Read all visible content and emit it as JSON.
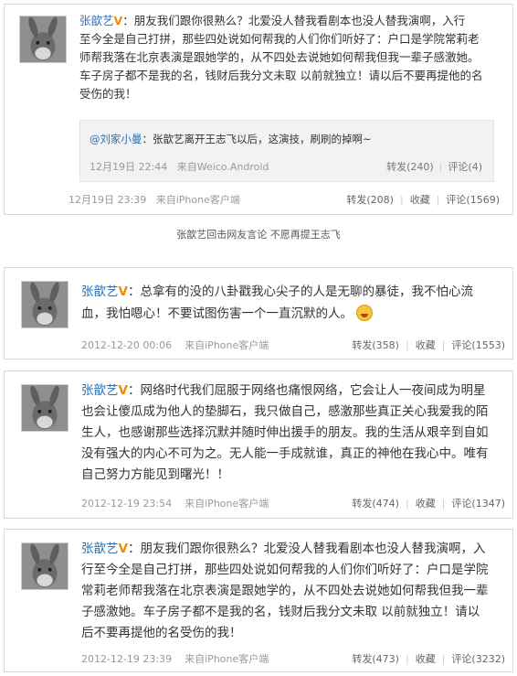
{
  "posts": [
    {
      "author": "张歆艺",
      "badge": "V",
      "text_lines": [
        "：朋友我们跟你很熟么？北爱没人替我看剧本也没人替我演啊，入行",
        "至今全是自己打拼，那些四处说如何帮我的人们你们听好了：户口是学院常莉老",
        "师帮我落在北京表演是跟她学的，从不四处去说她如何帮我但我一辈子感激她。",
        "车子房子都不是我的名，钱财后我分文未取 以前就独立！请以后不要再提他的名",
        "受伤的我！"
      ],
      "quote": {
        "author": "@刘家小曼",
        "text": "：张歆艺离开王志飞以后，这演技，刷刷的掉啊~",
        "time": "12月19日 22:44",
        "source": "来自Weico.Android",
        "repost": "转发(240)",
        "comment": "评论(4)"
      },
      "time": "12月19日 23:39",
      "source": "来自iPhone客户端",
      "repost": "转发(208)",
      "favorite": "收藏",
      "comment": "评论(1569)"
    },
    {
      "author": "张歆艺",
      "badge": "V",
      "text_lines": [
        "：总拿有的没的八卦戳我心尖子的人是无聊的暴徒，我不怕心流",
        "血，我怕嗯心！不要试图伤害一个一直沉默的人。"
      ],
      "time": "2012-12-20 00:06",
      "source": "来自iPhone客户端",
      "repost": "转发(358)",
      "favorite": "收藏",
      "comment": "评论(1553)"
    },
    {
      "author": "张歆艺",
      "badge": "V",
      "text_lines": [
        "：网络时代我们屈服于网络也痛恨网络，它会让人一夜间成为明星",
        "也会让傻瓜成为他人的垫脚石，我只做自己，感激那些真正关心我爱我的陌",
        "生人，也感谢那些选择沉默并随时伸出援手的朋友。我的生活从艰辛到自如",
        "没有强大的内心不可为之。无人能一手成就谁，真正的神他在我心中。唯有",
        "自己努力方能见到曙光！！"
      ],
      "time": "2012-12-19 23:54",
      "source": "来自iPhone客户端",
      "repost": "转发(474)",
      "favorite": "收藏",
      "comment": "评论(1347)"
    },
    {
      "author": "张歆艺",
      "badge": "V",
      "text_lines": [
        "：朋友我们跟你很熟么？北爱没人替我看剧本也没人替我演啊，入",
        "行至今全是自己打拼，那些四处说如何帮我的人们你们听好了：户口是学院",
        "常莉老师帮我落在北京表演是跟她学的，从不四处去说她如何帮我但我一辈",
        "子感激她。车子房子都不是我的名，钱财后我分文未取 以前就独立！请以",
        "后不要再提他的名受伤的我！"
      ],
      "time": "2012-12-19 23:39",
      "source": "来自iPhone客户端",
      "repost": "转发(473)",
      "favorite": "收藏",
      "comment": "评论(3232)"
    }
  ],
  "caption": "张歆艺回击网友言论  不愿再提王志飞",
  "icons": {
    "avatar": "donkey-avatar-icon",
    "emoji": "awkward-face-emoji-icon"
  },
  "colors": {
    "link": "#2b6fb3",
    "verified": "#f08a00",
    "meta": "#999999",
    "border": "#d9d9d9"
  }
}
